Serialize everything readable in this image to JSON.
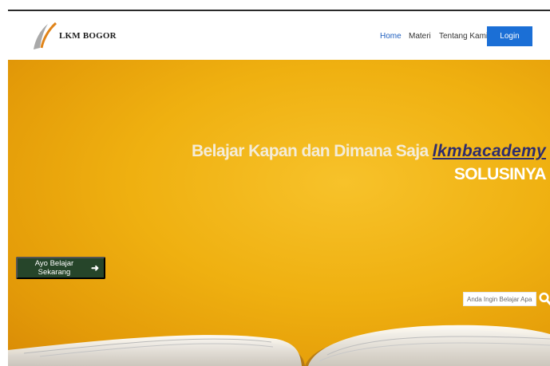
{
  "brand": {
    "logo_text": "LKM BOGOR"
  },
  "nav": {
    "items": [
      {
        "label": "Home"
      },
      {
        "label": "Materi"
      },
      {
        "label": "Tentang Kami"
      }
    ],
    "login_label": "Login"
  },
  "hero": {
    "title_prefix": "Belajar Kapan dan Dimana Saja ",
    "title_brand": "lkmbacademy",
    "title_line2": "SOLUSINYA",
    "cta_label": "Ayo Belajar Sekarang",
    "search_placeholder": "Anda Ingin Belajar Apa ..."
  },
  "colors": {
    "accent": "#1b6fd6",
    "hero_yellow": "#efb010",
    "cta_green": "#26452a",
    "brand_text": "#2e2c6e"
  },
  "icons": {
    "search": "search-icon",
    "cta_arrow": "arrow-right-icon",
    "logo_mark": "logo-swoosh-icon"
  }
}
